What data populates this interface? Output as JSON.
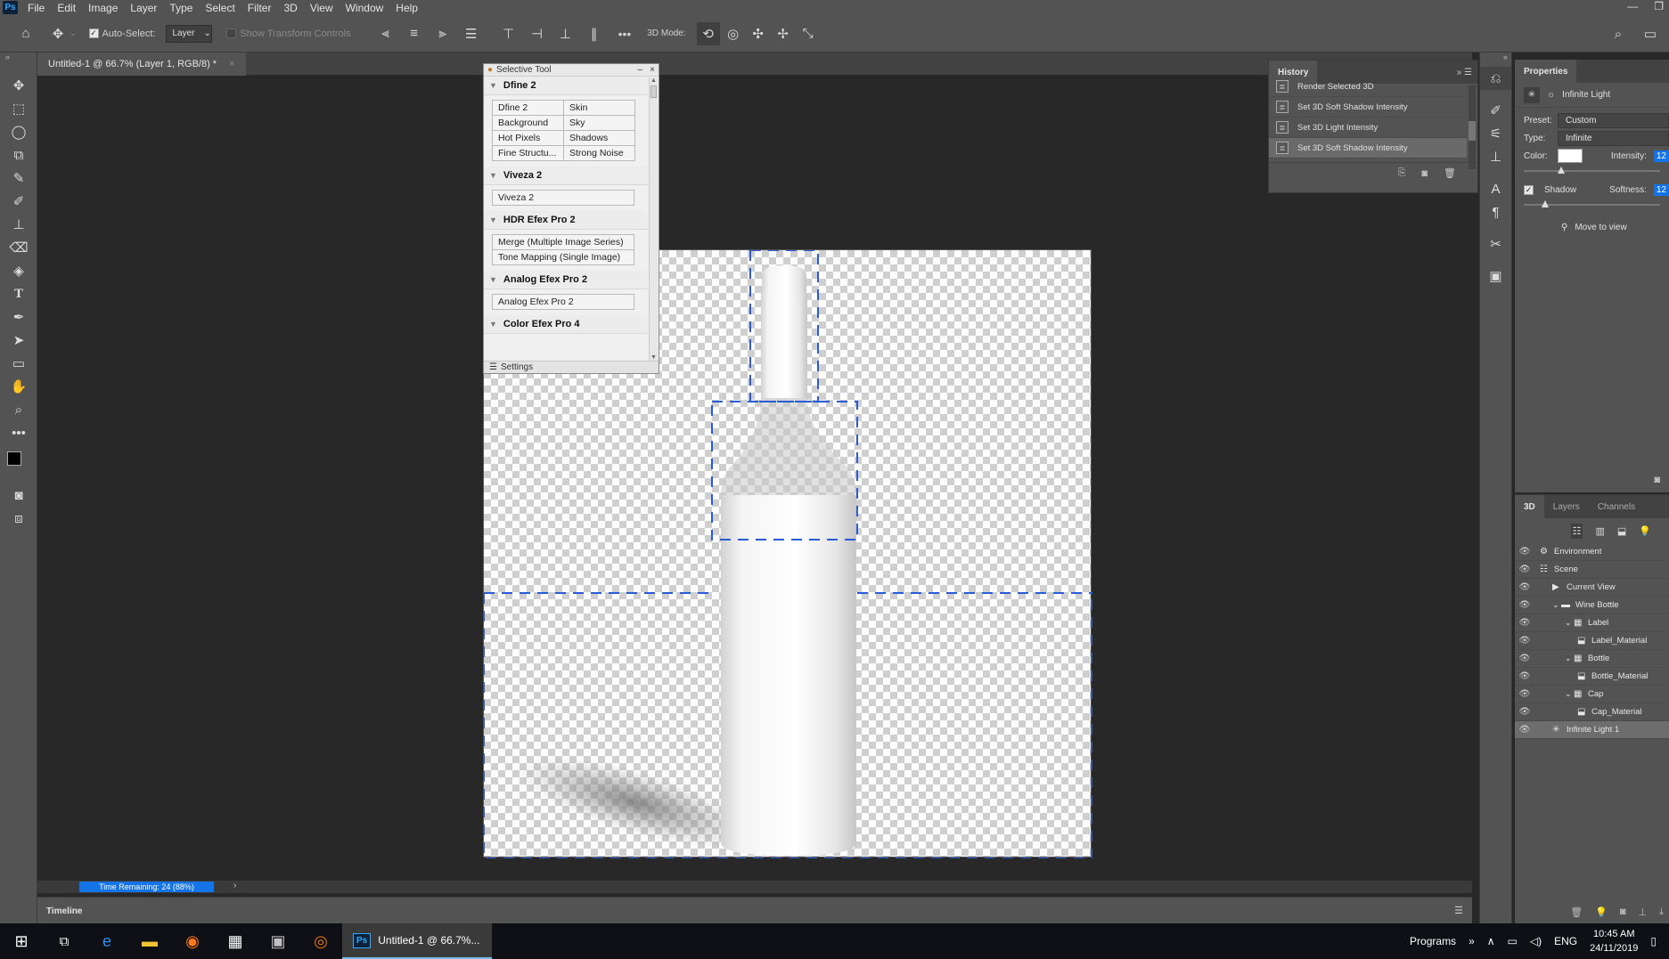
{
  "menubar": {
    "app_badge": "Ps",
    "items": [
      "File",
      "Edit",
      "Image",
      "Layer",
      "Type",
      "Select",
      "Filter",
      "3D",
      "View",
      "Window",
      "Help"
    ]
  },
  "options": {
    "auto_select_label": "Auto-Select:",
    "auto_select_value": "Layer",
    "show_transform_label": "Show Transform Controls",
    "mode_label": "3D Mode:",
    "more": "•••"
  },
  "document": {
    "tab_label": "Untitled-1 @ 66.7% (Layer 1, RGB/8) *",
    "close": "×"
  },
  "status": {
    "progress_label": "Time Remaining: 24 (88%)",
    "progress_fraction": 0.88
  },
  "timeline": {
    "label": "Timeline"
  },
  "selective_tool": {
    "title": "Selective Tool",
    "sections": [
      {
        "name": "Dfine 2",
        "buttons": [
          "Dfine 2",
          "Skin",
          "Background",
          "Sky",
          "Hot Pixels",
          "Shadows",
          "Fine Structu...",
          "Strong Noise"
        ]
      },
      {
        "name": "Viveza 2",
        "buttons": [
          "Viveza 2"
        ]
      },
      {
        "name": "HDR Efex Pro 2",
        "buttons": [
          "Merge (Multiple Image Series)",
          "Tone Mapping (Single Image)"
        ]
      },
      {
        "name": "Analog Efex Pro 2",
        "buttons": [
          "Analog Efex Pro 2"
        ]
      },
      {
        "name": "Color Efex Pro 4",
        "buttons": []
      }
    ],
    "footer": "Settings"
  },
  "history": {
    "tab": "History",
    "items": [
      "Render Selected 3D",
      "Set 3D Soft Shadow Intensity",
      "Set 3D Light Intensity",
      "Set 3D Soft Shadow Intensity"
    ],
    "active_index": 3
  },
  "properties": {
    "tab": "Properties",
    "light_name": "Infinite Light",
    "preset_label": "Preset:",
    "preset_value": "Custom",
    "type_label": "Type:",
    "type_value": "Infinite",
    "color_label": "Color:",
    "intensity_label": "Intensity:",
    "intensity_value": "12",
    "shadow_label": "Shadow",
    "softness_label": "Softness:",
    "softness_value": "12",
    "move_to_view": "Move to view"
  },
  "layers3d": {
    "tabs": [
      "3D",
      "Layers",
      "Channels"
    ],
    "active_tab": 0,
    "items": [
      {
        "label": "Environment",
        "indent": 0,
        "icon": "environment-icon"
      },
      {
        "label": "Scene",
        "indent": 0,
        "icon": "scene-icon"
      },
      {
        "label": "Current View",
        "indent": 1,
        "icon": "camera-icon"
      },
      {
        "label": "Wine Bottle",
        "indent": 1,
        "icon": "folder-icon"
      },
      {
        "label": "Label",
        "indent": 2,
        "icon": "mesh-icon"
      },
      {
        "label": "Label_Material",
        "indent": 3,
        "icon": "material-icon"
      },
      {
        "label": "Bottle",
        "indent": 2,
        "icon": "mesh-icon"
      },
      {
        "label": "Bottle_Material",
        "indent": 3,
        "icon": "material-icon"
      },
      {
        "label": "Cap",
        "indent": 2,
        "icon": "mesh-icon"
      },
      {
        "label": "Cap_Material",
        "indent": 3,
        "icon": "material-icon"
      },
      {
        "label": "Infinite Light 1",
        "indent": 1,
        "icon": "light-icon"
      }
    ],
    "active_index": 10
  },
  "taskbar": {
    "ps_label": "Untitled-1 @ 66.7%...",
    "programs": "Programs",
    "lang": "ENG",
    "time": "10:45 AM",
    "date": "24/11/2019"
  }
}
